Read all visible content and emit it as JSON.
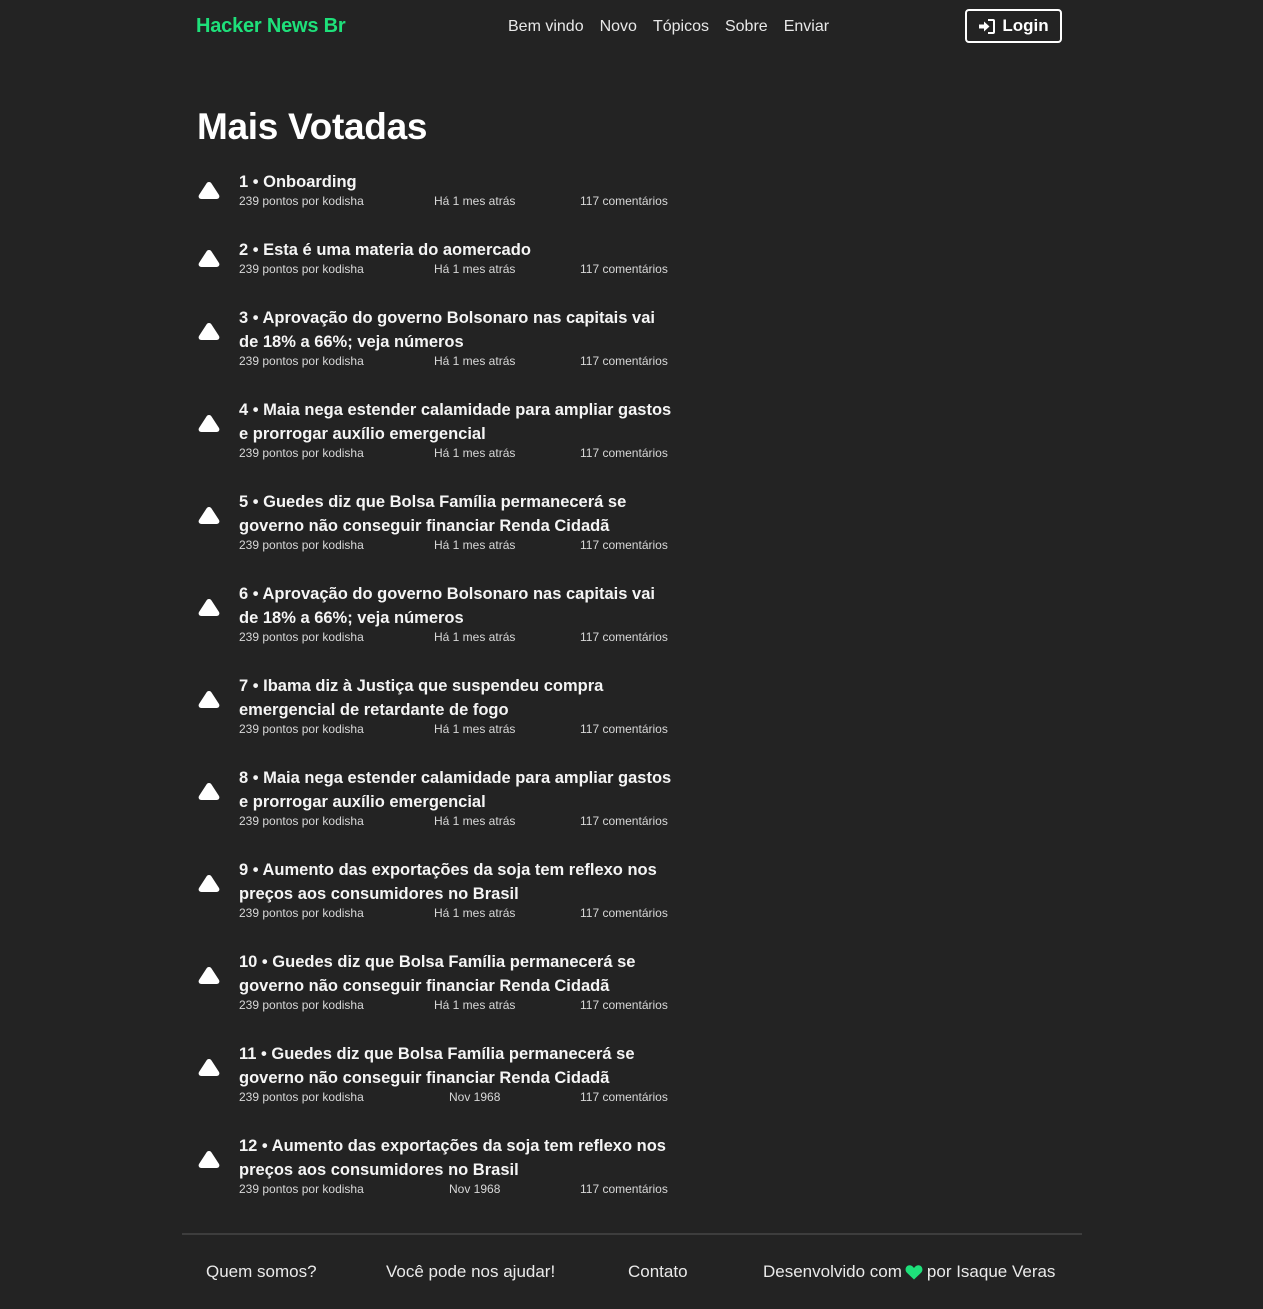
{
  "header": {
    "brand": "Hacker News Br",
    "nav": [
      "Bem vindo",
      "Novo",
      "Tópicos",
      "Sobre",
      "Enviar"
    ],
    "login_label": "Login",
    "accent_color": "#1ee07a"
  },
  "main": {
    "title": "Mais Votadas",
    "items": [
      {
        "title": "1 • Onboarding",
        "points": "239 pontos por kodisha",
        "time": "Há 1 mes atrás",
        "comments": "117 comentários"
      },
      {
        "title": "2 • Esta é uma materia do aomercado",
        "points": "239 pontos por kodisha",
        "time": "Há 1 mes atrás",
        "comments": "117 comentários"
      },
      {
        "title": "3 • Aprovação do governo Bolsonaro nas capitais vai de 18% a 66%; veja números",
        "points": "239 pontos por kodisha",
        "time": "Há 1 mes atrás",
        "comments": "117 comentários"
      },
      {
        "title": "4 • Maia nega estender calamidade para ampliar gastos e prorrogar auxílio emergencial",
        "points": "239 pontos por kodisha",
        "time": "Há 1 mes atrás",
        "comments": "117 comentários"
      },
      {
        "title": "5 • Guedes diz que Bolsa Família permanecerá se governo não conseguir financiar Renda Cidadã",
        "points": "239 pontos por kodisha",
        "time": "Há 1 mes atrás",
        "comments": "117 comentários"
      },
      {
        "title": "6 • Aprovação do governo Bolsonaro nas capitais vai de 18% a 66%; veja números",
        "points": "239 pontos por kodisha",
        "time": "Há 1 mes atrás",
        "comments": "117 comentários"
      },
      {
        "title": "7 • Ibama diz à Justiça que suspendeu compra emergencial de retardante de fogo",
        "points": "239 pontos por kodisha",
        "time": "Há 1 mes atrás",
        "comments": "117 comentários"
      },
      {
        "title": "8 • Maia nega estender calamidade para ampliar gastos e prorrogar auxílio emergencial",
        "points": "239 pontos por kodisha",
        "time": "Há 1 mes atrás",
        "comments": "117 comentários"
      },
      {
        "title": "9 • Aumento das exportações da soja tem reflexo nos preços aos consumidores no Brasil",
        "points": "239 pontos por kodisha",
        "time": "Há 1 mes atrás",
        "comments": "117 comentários"
      },
      {
        "title": "10 • Guedes diz que Bolsa Família permanecerá se governo não conseguir financiar Renda Cidadã",
        "points": "239 pontos por kodisha",
        "time": "Há 1 mes atrás",
        "comments": "117 comentários"
      },
      {
        "title": "11 • Guedes diz que Bolsa Família permanecerá se governo não conseguir financiar Renda Cidadã",
        "points": "239 pontos por kodisha",
        "time": "Nov 1968",
        "comments": "117 comentários"
      },
      {
        "title": "12 • Aumento das exportações da soja tem reflexo nos preços aos consumidores no Brasil",
        "points": "239 pontos por kodisha",
        "time": "Nov 1968",
        "comments": "117 comentários"
      }
    ]
  },
  "footer": {
    "about": "Quem somos?",
    "help": "Você pode nos ajudar!",
    "contact": "Contato",
    "credit_before": "Desenvolvido com",
    "credit_after": "por Isaque Veras",
    "heart_icon": "heart-icon",
    "heart_color": "#1ee07a"
  }
}
